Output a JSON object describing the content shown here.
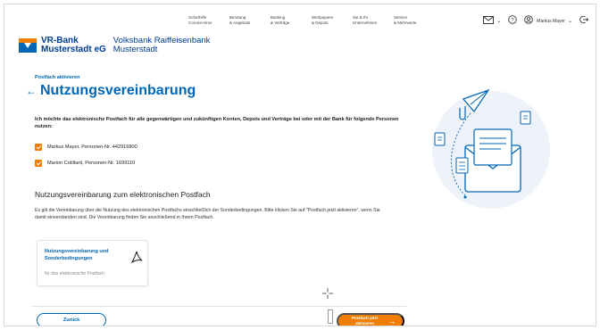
{
  "header": {
    "bank_name_line1": "VR-Bank",
    "bank_name_line2": "Musterstadt eG",
    "bank_subtitle_line1": "Volksbank Raiffeisenbank",
    "bank_subtitle_line2": "Musterstadt",
    "nav": [
      {
        "line1": "Soforthilfe",
        "line2": "Corona-Virus"
      },
      {
        "line1": "Beratung",
        "line2": "& Angebote"
      },
      {
        "line1": "Banking",
        "line2": "& Verträge"
      },
      {
        "line1": "Wertpapiere",
        "line2": "& Depots"
      },
      {
        "line1": "Sie & Ihr",
        "line2": "Unternehmen"
      },
      {
        "line1": "Service",
        "line2": "& Mehrwerte"
      }
    ],
    "user_name": "Markus Mayer",
    "mail_icon": "mail-icon",
    "help_icon": "help-icon",
    "user_icon": "user-icon",
    "logout_icon": "logout-icon"
  },
  "page": {
    "breadcrumb": "Postfach aktivieren",
    "title": "Nutzungsvereinbarung",
    "intro": "Ich möchte das elektronische Postfach für alle gegenwärtigen und zukünftigen Konten, Depots und Verträge bei oder mit der Bank für folgende Personen nutzen:",
    "persons": [
      {
        "label": "Markus Mayer, Personen-Nr. 442916800",
        "checked": true
      },
      {
        "label": "Marion Cotillard, Personen-Nr. 1699110",
        "checked": true
      }
    ],
    "section_title": "Nutzungsvereinbarung zum elektronischen Postfach",
    "section_text": "Es gilt die Vereinbarung über die Nutzung des elektronischen Postfachs einschließlich der Sonderbedingungen. Bitte klicken Sie auf \"Postfach jetzt aktivieren\", wenn Sie damit einverstanden sind. Die Vereinbarung finden Sie anschließend in Ihrem Postfach.",
    "document": {
      "title": "Nutzungsvereinbarung und Sonderbedingungen",
      "subtitle": "für das elektronische Postfach",
      "icon": "pdf-icon"
    }
  },
  "footer": {
    "back_label": "Zurück",
    "primary_label": "Postfach jetzt aktivieren",
    "primary_icon": "arrow-right-icon"
  },
  "colors": {
    "brand_blue": "#0066b3",
    "brand_orange": "#f07d00"
  }
}
